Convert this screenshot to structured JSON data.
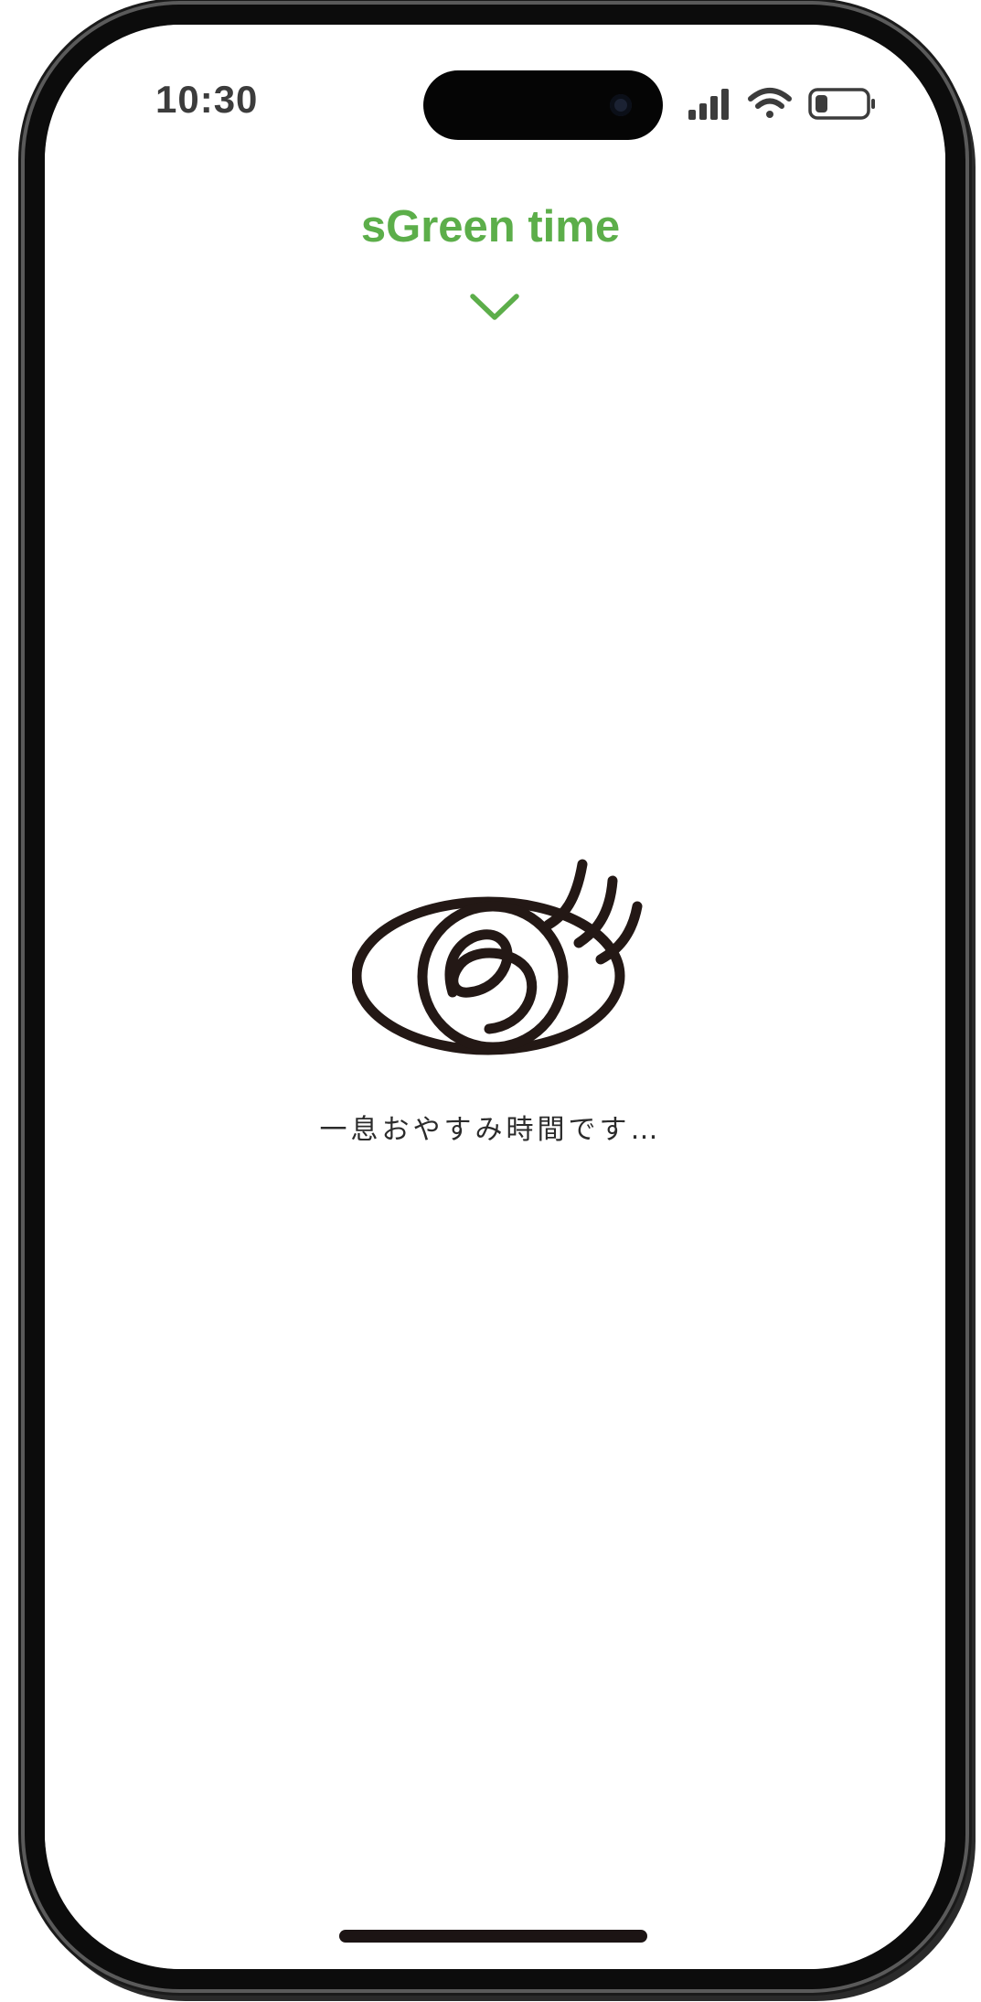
{
  "status_bar": {
    "time": "10:30",
    "icons": [
      "signal-icon",
      "wifi-icon",
      "battery-icon"
    ],
    "battery_level": 0.25
  },
  "app": {
    "title": "sGreen time",
    "accent_color": "#5cae4a",
    "toggle_icon": "chevron-down-icon"
  },
  "main": {
    "logo_icon": "eye-logo-icon",
    "message": "一息おやすみ時間です…"
  }
}
